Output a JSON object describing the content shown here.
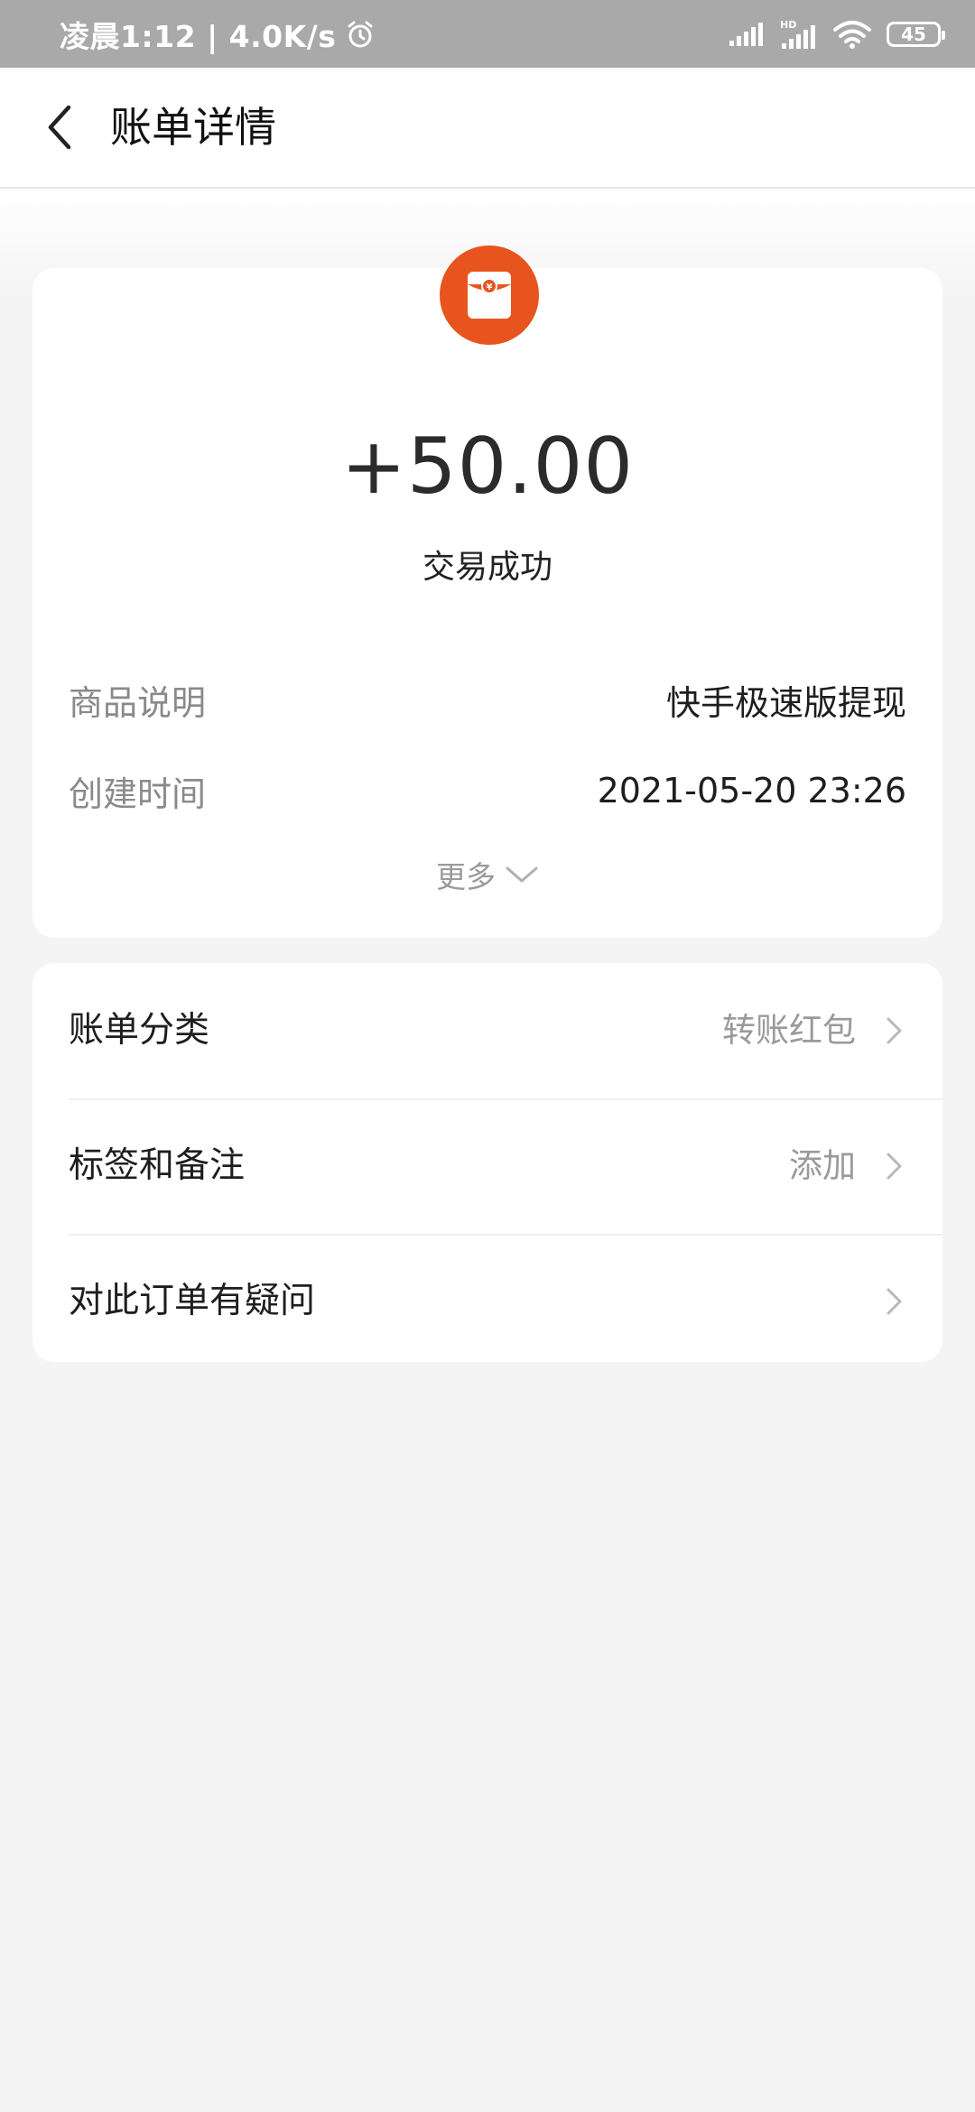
{
  "status_bar": {
    "time_speed": "凌晨1:12 | 4.0K/s",
    "battery": "45"
  },
  "header": {
    "title": "账单详情"
  },
  "transaction": {
    "amount": "+50.00",
    "status": "交易成功",
    "icon": "red-packet-icon",
    "icon_color": "#e8541e"
  },
  "details": [
    {
      "label": "商品说明",
      "value": "快手极速版提现"
    },
    {
      "label": "创建时间",
      "value": "2021-05-20 23:26"
    }
  ],
  "more_label": "更多",
  "menu": [
    {
      "label": "账单分类",
      "value": "转账红包"
    },
    {
      "label": "标签和备注",
      "value": "添加"
    },
    {
      "label": "对此订单有疑问",
      "value": ""
    }
  ]
}
